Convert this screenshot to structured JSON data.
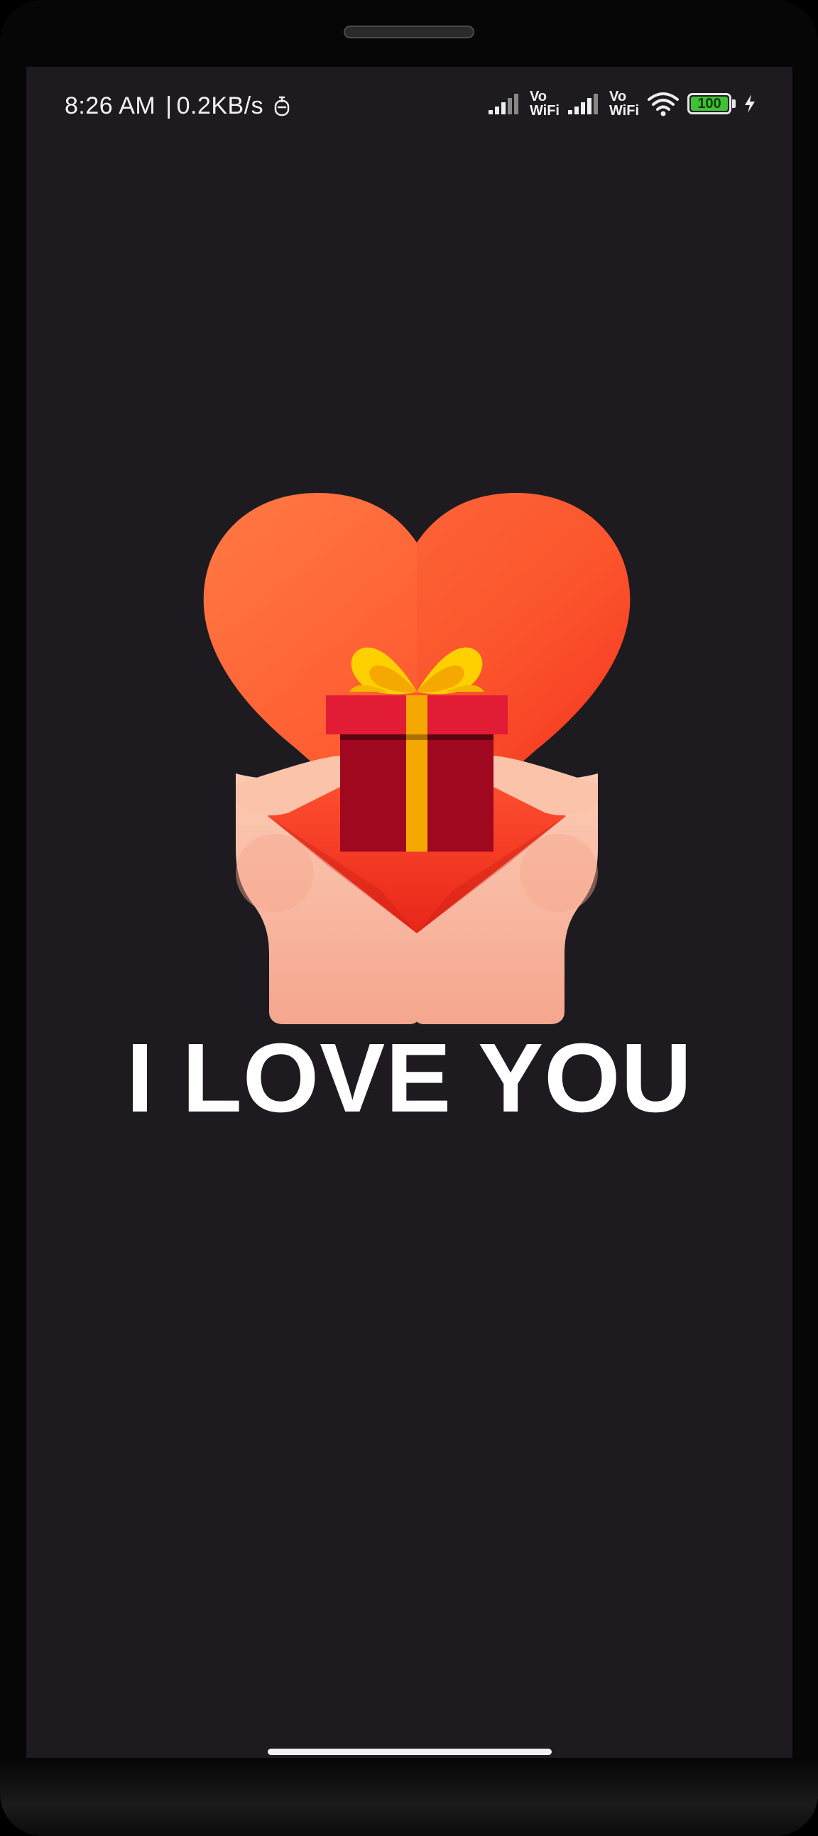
{
  "status_bar": {
    "time": "8:26 AM",
    "separator": "|",
    "speed": "0.2KB/s",
    "volte_1_top": "Vo",
    "volte_1_bottom": "WiFi",
    "volte_2_top": "Vo",
    "volte_2_bottom": "WiFi",
    "battery_level": "100",
    "icons": [
      "data-saver-icon",
      "signal-icon",
      "signal-icon",
      "wifi-icon",
      "battery-icon",
      "charging-icon"
    ]
  },
  "main": {
    "headline": "I LOVE YOU",
    "illustration": "hands-holding-heart-gift"
  },
  "colors": {
    "screen_background": "#1d1b20",
    "headline": "#ffffff",
    "heart_top": "#ff7a45",
    "heart_bottom": "#f5251b",
    "gift_box": "#a00820",
    "gift_lid": "#e31c35",
    "ribbon": "#f5a800",
    "bow": "#ffd000",
    "hands": "#f9b9a0"
  }
}
